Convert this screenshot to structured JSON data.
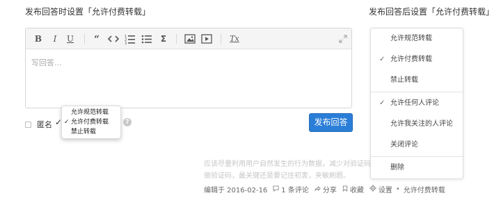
{
  "captions": {
    "before": "发布回答时设置「允许付费转载」",
    "after": "发布回答后设置「允许付费转载」"
  },
  "editor": {
    "placeholder": "写回答…",
    "toolbar": {
      "bold": "B",
      "italic": "I",
      "underline": "U",
      "sigma": "Σ",
      "clear_format": "Tx"
    }
  },
  "anonymous_label": "匿名",
  "repost_menu": {
    "options": [
      {
        "label": "允许规范转载",
        "checked": false
      },
      {
        "label": "允许付费转载",
        "checked": true
      },
      {
        "label": "禁止转载",
        "checked": false
      }
    ],
    "check_mark": "✓"
  },
  "help_icon": "?",
  "submit_label": "发布回答",
  "hint": {
    "line1": "应该尽量利用用户自然发生的行为数据，减少对验证码",
    "line2": "做验证码，最关键还是要记住初衷，夹敏刷题。"
  },
  "footer": {
    "edited": "编辑于 2016-02-16",
    "comments": "1 条评论",
    "share": "分享",
    "favorite": "收藏",
    "settings": "设置",
    "separator": "•",
    "repost_status": "允许付费转载"
  },
  "settings_panel": {
    "check_mark": "✓",
    "repost_group": [
      {
        "label": "允许规范转载",
        "checked": false
      },
      {
        "label": "允许付费转载",
        "checked": true
      },
      {
        "label": "禁止转载",
        "checked": false
      }
    ],
    "comment_group": [
      {
        "label": "允许任何人评论",
        "checked": true
      },
      {
        "label": "允许我关注的人评论",
        "checked": false
      },
      {
        "label": "关闭评论",
        "checked": false
      }
    ],
    "delete_label": "删除"
  }
}
